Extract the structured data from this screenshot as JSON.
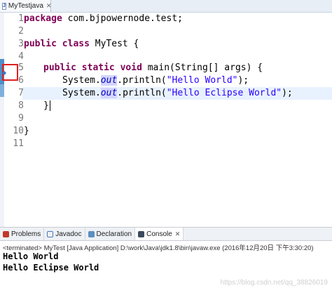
{
  "editor_tab": {
    "title": "MyTestjava",
    "close": "✕"
  },
  "gutter": {
    "lines": [
      "1",
      "2",
      "3",
      "4",
      "5",
      "6",
      "7",
      "8",
      "9",
      "10",
      "11"
    ]
  },
  "code": {
    "l1_kw": "package",
    "l1_rest": " com.bjpowernode.test;",
    "l3_kw1": "public",
    "l3_kw2": "class",
    "l3_rest": " MyTest {",
    "l5_kw1": "public",
    "l5_kw2": "static",
    "l5_kw3": "void",
    "l5_rest": " main(String[] args) {",
    "l6_pre": "System.",
    "l6_fld": "out",
    "l6_mid": ".println(",
    "l6_str": "\"Hello World\"",
    "l6_end": ");",
    "l7_pre": "System.",
    "l7_fld": "out",
    "l7_mid": ".println(",
    "l7_str": "\"Hello Eclipse World\"",
    "l7_end": ");",
    "l8": "}",
    "l10": "}"
  },
  "views": {
    "tabs": [
      {
        "label": "Problems",
        "icon": "problems-icon",
        "color": "#c0392b"
      },
      {
        "label": "Javadoc",
        "icon": "javadoc-icon",
        "color": "#4a7ab5"
      },
      {
        "label": "Declaration",
        "icon": "declaration-icon",
        "color": "#5c8fc2"
      },
      {
        "label": "Console",
        "icon": "console-icon",
        "color": "#3b4a5e"
      }
    ],
    "console_close": "✕",
    "terminated": "<terminated> MyTest [Java Application] D:\\work\\Java\\jdk1.8\\bin\\javaw.exe (2016年12月20日 下午3:30:20)",
    "output": [
      "Hello World",
      "Hello Eclipse World"
    ],
    "watermark": "https://blog.csdn.net/qq_38826019"
  }
}
